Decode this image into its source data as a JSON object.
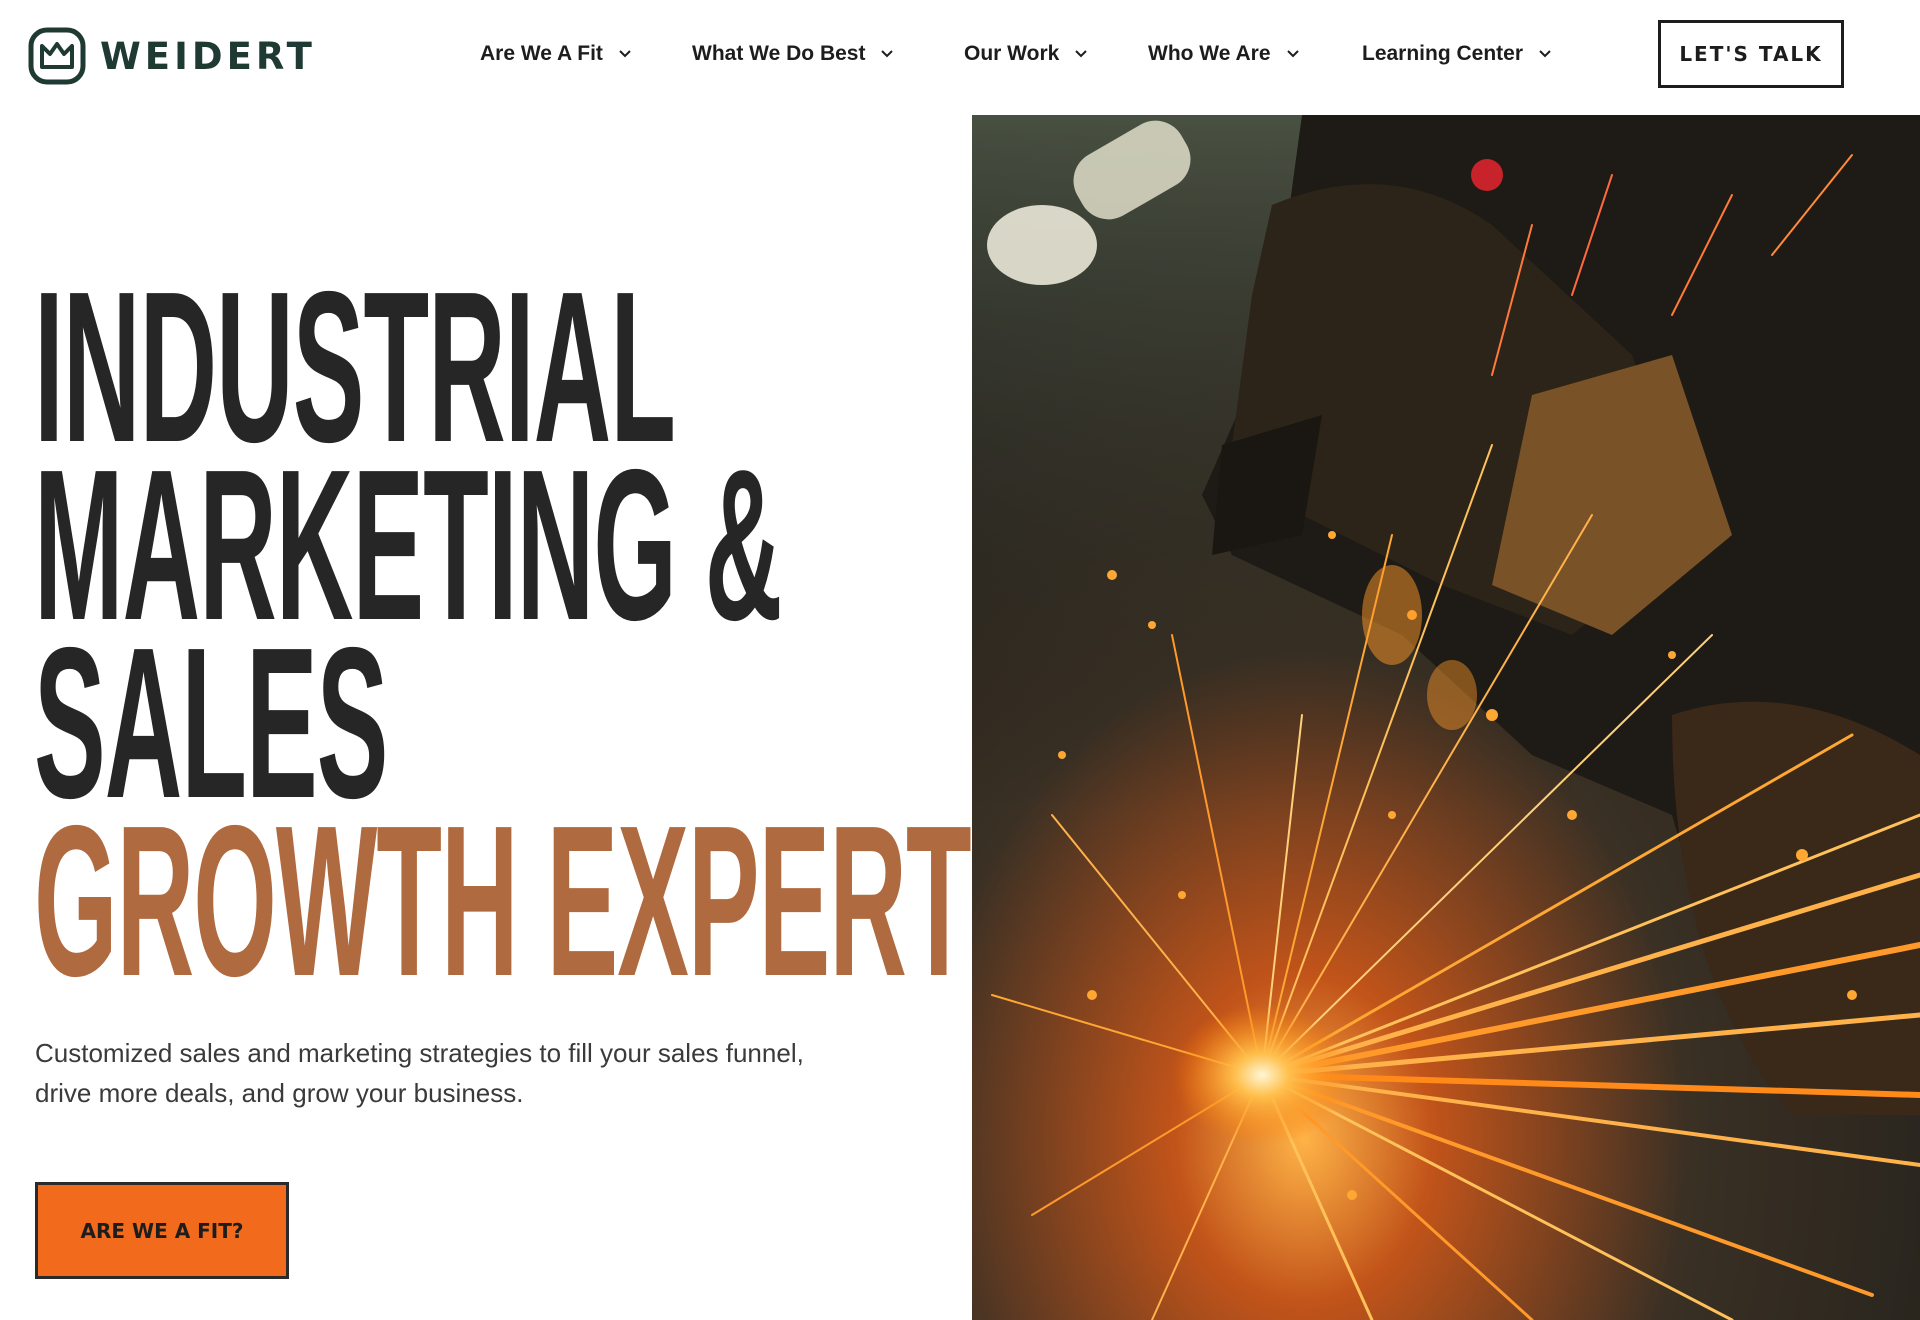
{
  "brand": {
    "name": "WEIDERT",
    "color": "#1f3a33",
    "logo_icon": "crown-badge-icon"
  },
  "nav": {
    "items": [
      {
        "label": "Are We A Fit",
        "icon": "chevron-down-icon"
      },
      {
        "label": "What We Do Best",
        "icon": "chevron-down-icon"
      },
      {
        "label": "Our Work",
        "icon": "chevron-down-icon"
      },
      {
        "label": "Who We Are",
        "icon": "chevron-down-icon"
      },
      {
        "label": "Learning Center",
        "icon": "chevron-down-icon"
      }
    ],
    "cta_label": "LET'S TALK"
  },
  "hero": {
    "title_lines": [
      "INDUSTRIAL",
      "MARKETING &",
      "SALES"
    ],
    "title_accent": "GROWTH EXPERTS",
    "subtitle": "Customized sales and marketing strategies to fill your sales funnel, drive more deals, and grow your business.",
    "cta_label": "ARE WE A FIT?",
    "image_subject": "welder grinding metal with orange sparks"
  },
  "colors": {
    "accent_orange": "#f26a1b",
    "accent_copper": "#b06a3f",
    "text_dark": "#262626"
  }
}
